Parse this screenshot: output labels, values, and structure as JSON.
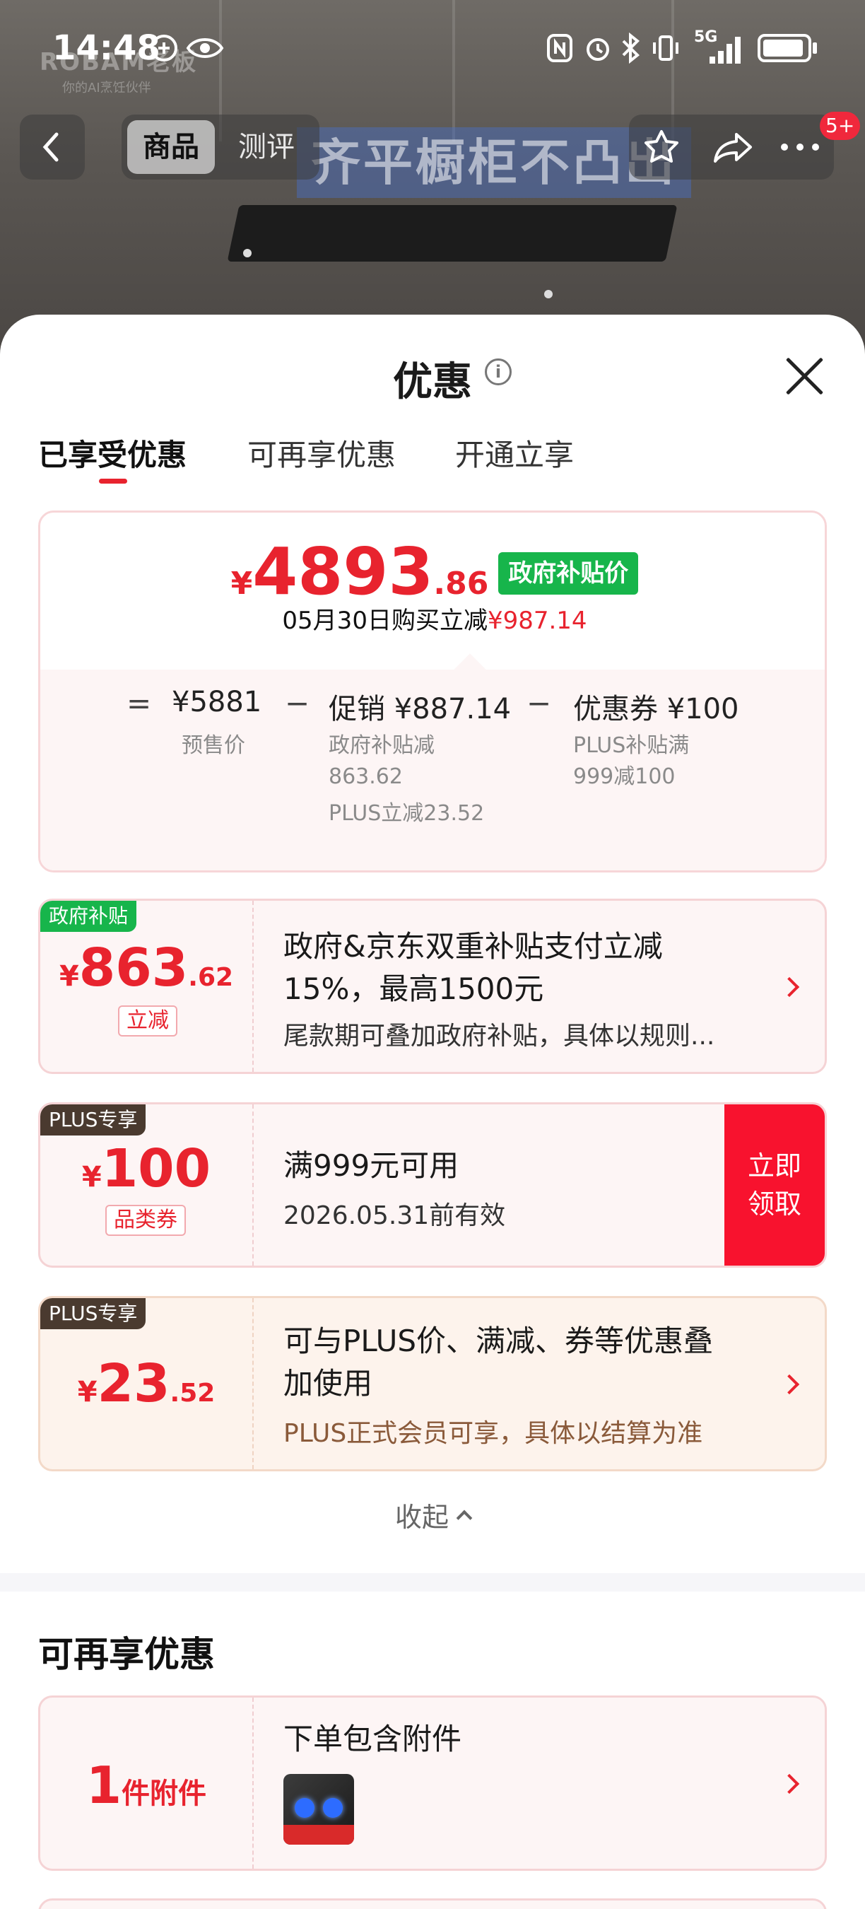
{
  "status_bar": {
    "time": "14:48",
    "network": "5G"
  },
  "backdrop": {
    "brand": "ROBAM老板",
    "brand_sub": "你的AI烹饪伙伴",
    "overlay_text": "齐平橱柜不凸出"
  },
  "nav": {
    "tabs": [
      "商品",
      "测评"
    ],
    "active_tab": "商品",
    "badge": "5+"
  },
  "sheet": {
    "title": "优惠",
    "tabs": [
      "已享受优惠",
      "可再享优惠",
      "开通立享"
    ],
    "active_tab": "已享受优惠"
  },
  "price_card": {
    "currency": "¥",
    "price_int": "4893",
    "price_dec": ".86",
    "badge": "政府补贴价",
    "buy_line_prefix": "05月30日购买立减",
    "buy_line_amount": "¥987.14",
    "breakdown": {
      "eq": "=",
      "presale_value": "¥5881",
      "presale_label": "预售价",
      "minus1": "−",
      "promo_value": "促销 ¥887.14",
      "promo_sub1": "政府补贴减",
      "promo_sub2": "863.62",
      "promo_sub3": "PLUS立减23.52",
      "minus2": "−",
      "coupon_value": "优惠券 ¥100",
      "coupon_sub1": "PLUS补贴满",
      "coupon_sub2": "999减100"
    }
  },
  "coupons": [
    {
      "tag": "政府补贴",
      "tag_color": "#17b54b",
      "currency": "¥",
      "int": "863",
      "dec": ".62",
      "small_tag": "立减",
      "line1": "政府&京东双重补贴支付立减",
      "line2": "15%，最高1500元",
      "line3": "尾款期可叠加政府补贴，具体以规则..."
    },
    {
      "tag": "PLUS专享",
      "tag_color": "#4a3a2f",
      "currency": "¥",
      "int": "100",
      "small_tag": "品类券",
      "line1": "满999元可用",
      "line2": "2026.05.31前有效",
      "claim_label_1": "立即",
      "claim_label_2": "领取"
    },
    {
      "tag": "PLUS专享",
      "tag_color": "#4a3a2f",
      "currency": "¥",
      "int": "23",
      "dec": ".52",
      "line1": "可与PLUS价、满减、券等优惠叠",
      "line2": "加使用",
      "line3": "PLUS正式会员可享，具体以结算为准"
    }
  ],
  "collapse_label": "收起",
  "section2": {
    "title": "可再享优惠",
    "accessory": {
      "count": "1",
      "unit": "件附件",
      "title": "下单包含附件"
    }
  },
  "colors": {
    "accent": "#e8232e",
    "gov_green": "#17b54b",
    "plus_brown": "#4a3a2f",
    "claim_red": "#f8122e"
  }
}
